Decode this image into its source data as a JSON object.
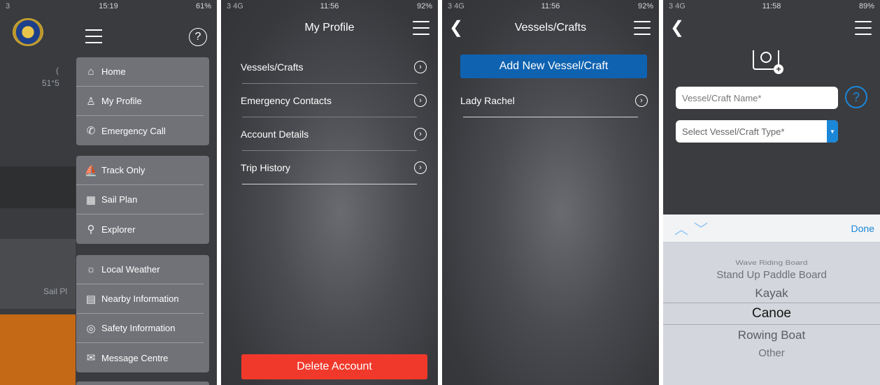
{
  "screen1": {
    "status": {
      "carrier": "3",
      "time": "15:19",
      "battery": "61%"
    },
    "background_text": {
      "coord": "51°5",
      "sail_plan_partial": "Sail Pl",
      "left_letter": "("
    },
    "menu_groups": [
      [
        {
          "label": "Home",
          "icon": "home-icon"
        },
        {
          "label": "My Profile",
          "icon": "user-icon"
        },
        {
          "label": "Emergency Call",
          "icon": "phone-icon"
        }
      ],
      [
        {
          "label": "Track Only",
          "icon": "boat-icon"
        },
        {
          "label": "Sail Plan",
          "icon": "map-icon"
        },
        {
          "label": "Explorer",
          "icon": "location-pin-icon"
        }
      ],
      [
        {
          "label": "Local Weather",
          "icon": "sun-cloud-icon"
        },
        {
          "label": "Nearby Information",
          "icon": "info-pin-icon"
        },
        {
          "label": "Safety Information",
          "icon": "lifebuoy-icon"
        },
        {
          "label": "Message Centre",
          "icon": "megaphone-icon"
        }
      ]
    ]
  },
  "screen2": {
    "status": {
      "carrier": "3 4G",
      "time": "11:56",
      "battery": "92%"
    },
    "title": "My Profile",
    "rows": [
      "Vessels/Crafts",
      "Emergency Contacts",
      "Account Details",
      "Trip History"
    ],
    "delete_label": "Delete Account"
  },
  "screen3": {
    "status": {
      "carrier": "3 4G",
      "time": "11:56",
      "battery": "92%"
    },
    "title": "Vessels/Crafts",
    "add_label": "Add New Vessel/Craft",
    "vessels": [
      "Lady Rachel"
    ]
  },
  "screen4": {
    "status": {
      "carrier": "3 4G",
      "time": "11:58",
      "battery": "89%"
    },
    "name_placeholder": "Vessel/Craft Name*",
    "type_placeholder": "Select Vessel/Craft Type*",
    "help_symbol": "?",
    "done_label": "Done",
    "picker_options": [
      "Wave Riding Board",
      "Stand Up Paddle Board",
      "Kayak",
      "Canoe",
      "Rowing Boat",
      "Other"
    ],
    "picker_selected": "Canoe"
  },
  "colors": {
    "accent_blue": "#0f62b0",
    "danger_red": "#f0392b",
    "link_blue": "#1b87d8"
  }
}
